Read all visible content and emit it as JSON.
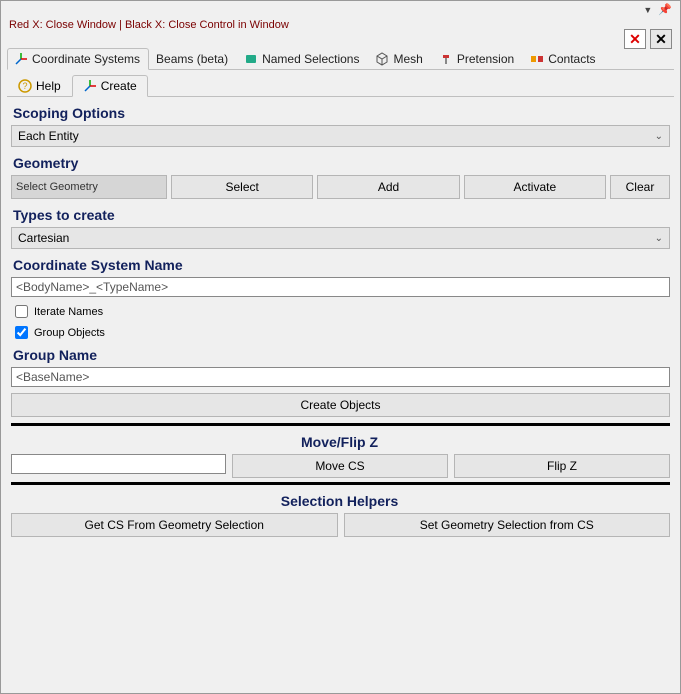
{
  "hint": "Red X: Close Window | Black X: Close Control in Window",
  "tabs": {
    "coordinate_systems": "Coordinate Systems",
    "beams": "Beams (beta)",
    "named_selections": "Named Selections",
    "mesh": "Mesh",
    "pretension": "Pretension",
    "contacts": "Contacts"
  },
  "subtabs": {
    "help": "Help",
    "create": "Create"
  },
  "sections": {
    "scoping_options": "Scoping Options",
    "geometry": "Geometry",
    "types_to_create": "Types to create",
    "cs_name": "Coordinate System Name",
    "group_name": "Group Name",
    "moveflip": "Move/Flip Z",
    "selection_helpers": "Selection Helpers"
  },
  "scoping": {
    "value": "Each Entity"
  },
  "geometry": {
    "label": "Select Geometry",
    "select": "Select",
    "add": "Add",
    "activate": "Activate",
    "clear": "Clear"
  },
  "types": {
    "value": "Cartesian"
  },
  "cs_name_value": "<BodyName>_<TypeName>",
  "iterate_names_label": "Iterate Names",
  "group_objects_label": "Group Objects",
  "group_name_value": "<BaseName>",
  "create_objects": "Create Objects",
  "moveflip": {
    "move": "Move CS",
    "flip": "Flip Z"
  },
  "helpers": {
    "get": "Get CS From Geometry Selection",
    "set": "Set Geometry Selection from CS"
  }
}
